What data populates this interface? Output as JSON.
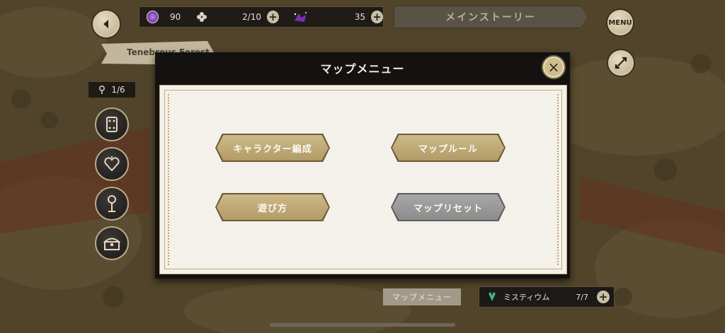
{
  "top_bar": {
    "back_icon": "chevron-left-icon",
    "gem_count": "90",
    "item_count": "2/10",
    "crystal_count": "35",
    "story_label": "メインストーリー",
    "menu_label": "MENU",
    "expand_icon": "expand-arrows-icon"
  },
  "location_banner": "Tenebrous Forest",
  "side_panel": {
    "counter": "1/6",
    "buttons": [
      "cards-icon",
      "heart-icon",
      "torch-icon",
      "treasure-chest-icon"
    ]
  },
  "modal": {
    "title": "マップメニュー",
    "close_icon": "close-icon",
    "buttons": {
      "character_formation": "キャラクター編成",
      "map_rules": "マップルール",
      "how_to_play": "遊び方",
      "map_reset": "マップリセット"
    }
  },
  "bottom_bar": {
    "map_menu_label": "マップメニュー",
    "mystium_label": "ミスティウム",
    "mystium_count": "7/7"
  },
  "colors": {
    "gold_button": "#c2ab7b",
    "gray_button": "#9a9a9a",
    "modal_bg": "#141210",
    "panel_bg": "#f4f1ea"
  }
}
